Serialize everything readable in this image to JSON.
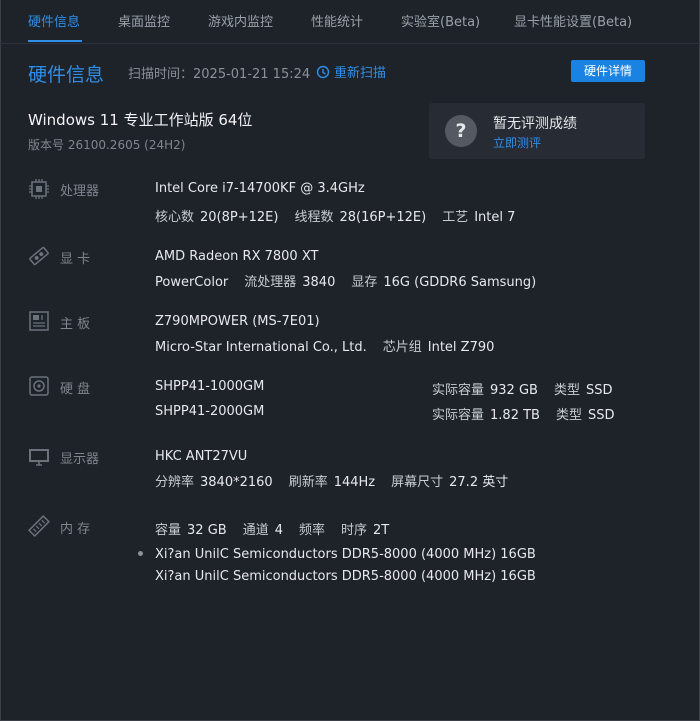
{
  "tabs": [
    "硬件信息",
    "桌面监控",
    "游戏内监控",
    "性能统计",
    "实验室(Beta)",
    "显卡性能设置(Beta)"
  ],
  "header": {
    "title": "硬件信息",
    "scan_time": "扫描时间：2025-01-21 15:24",
    "rescan": "重新扫描",
    "detail_button": "硬件详情"
  },
  "os": {
    "name": "Windows 11 专业工作站版 64位",
    "version": "版本号  26100.2605 (24H2)"
  },
  "score": {
    "icon": "?",
    "title": "暂无评测成绩",
    "link": "立即测评"
  },
  "cpu": {
    "label": "处理器",
    "icon": "cpu-chip-icon",
    "model": "Intel Core i7-14700KF @ 3.4GHz",
    "cores_label": "核心数",
    "cores_value": "20(8P+12E)",
    "threads_label": "线程数",
    "threads_value": "28(16P+12E)",
    "process_label": "工艺",
    "process_value": "Intel 7"
  },
  "gpu": {
    "label": "显 卡",
    "icon": "graphics-card-icon",
    "model": "AMD Radeon RX 7800 XT",
    "vendor": "PowerColor",
    "sp_label": "流处理器",
    "sp_value": "3840",
    "vram_label": "显存",
    "vram_value": "16G (GDDR6 Samsung)"
  },
  "board": {
    "label": "主 板",
    "icon": "motherboard-icon",
    "model": "Z790MPOWER (MS-7E01)",
    "vendor": "Micro-Star International Co., Ltd.",
    "chipset_label": "芯片组",
    "chipset_value": "Intel Z790"
  },
  "disk": {
    "label": "硬 盘",
    "icon": "hard-disk-icon",
    "drives": [
      {
        "model": "SHPP41-1000GM",
        "cap_label": "实际容量",
        "cap_value": "932 GB",
        "type_label": "类型",
        "type_value": "SSD"
      },
      {
        "model": "SHPP41-2000GM",
        "cap_label": "实际容量",
        "cap_value": "1.82 TB",
        "type_label": "类型",
        "type_value": "SSD"
      }
    ]
  },
  "monitor": {
    "label": "显示器",
    "icon": "monitor-icon",
    "model": "HKC ANT27VU",
    "res_label": "分辨率",
    "res_value": "3840*2160",
    "refresh_label": "刷新率",
    "refresh_value": "144Hz",
    "size_label": "屏幕尺寸",
    "size_value": "27.2 英寸"
  },
  "memory": {
    "label": "内 存",
    "icon": "memory-stick-icon",
    "cap_label": "容量",
    "cap_value": "32 GB",
    "channel_label": "通道",
    "channel_value": "4",
    "freq_label": "频率",
    "timing_label": "时序",
    "timing_value": "2T",
    "modules": [
      "Xi?an UnilC Semiconductors DDR5-8000 (4000 MHz) 16GB",
      "Xi?an UnilC Semiconductors DDR5-8000 (4000 MHz) 16GB"
    ]
  },
  "colors": {
    "accent": "#2f8fe8",
    "background": "#1e2229",
    "card": "#272b33",
    "muted": "#7f868f"
  }
}
